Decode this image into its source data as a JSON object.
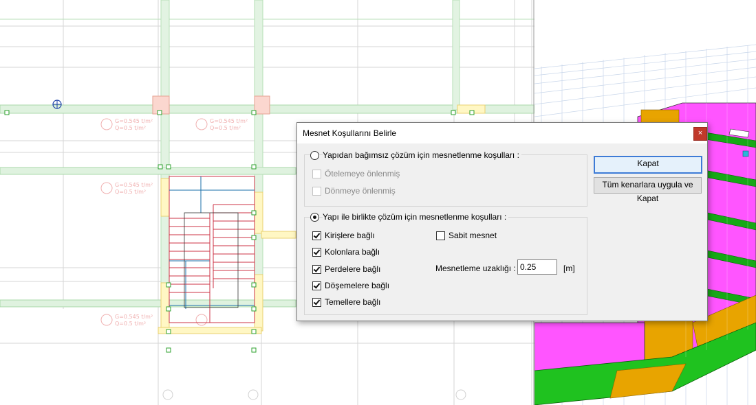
{
  "dialog": {
    "title": "Mesnet Koşullarını Belirle",
    "close_symbol": "×",
    "independent_group": {
      "label": "Yapıdan bağımsız çözüm için mesnetlenme koşulları  :",
      "selected": false,
      "options": [
        {
          "label": "Ötelemeye önlenmiş",
          "checked": false,
          "enabled": false
        },
        {
          "label": "Dönmeye önlenmiş",
          "checked": false,
          "enabled": false
        }
      ]
    },
    "combined_group": {
      "label": "Yapı ile birlikte çözüm için mesnetlenme koşulları  :",
      "selected": true,
      "options": [
        {
          "label": "Kirişlere bağlı",
          "checked": true
        },
        {
          "label": "Kolonlara bağlı",
          "checked": true
        },
        {
          "label": "Perdelere bağlı",
          "checked": true
        },
        {
          "label": "Döşemelere bağlı",
          "checked": true
        },
        {
          "label": "Temellere bağlı",
          "checked": true
        }
      ],
      "fixed_support": {
        "label": "Sabit mesnet",
        "checked": false
      },
      "distance": {
        "label": "Mesnetleme uzaklığı  :",
        "value": "0.25",
        "unit": "[m]"
      }
    },
    "buttons": {
      "close": "Kapat",
      "apply_all_close": "Tüm kenarlara uygula ve Kapat"
    }
  },
  "plan": {
    "labels": {
      "q_top_1": "Q=0.5 t/m²",
      "g_top_1": "G=0.545 t/m²",
      "q_top_2": "Q=0.5 t/m²",
      "g_top_2": "G=0.545 t/m²",
      "g_mid": "G=0.545 t/m²",
      "q_mid": "Q=0.5 t/m²",
      "g_bot": "G=0.545 t/m²",
      "q_bot": "Q=0.5 t/m²"
    }
  },
  "colors": {
    "accent": "#3d7bd6",
    "close_red": "#c0392b",
    "magenta": "#ff55ff",
    "orange": "#e8a400",
    "green": "#1fc21f"
  }
}
